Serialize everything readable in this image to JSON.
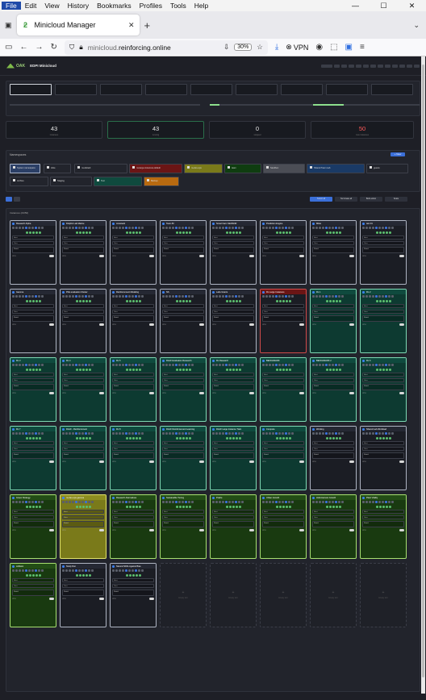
{
  "browser": {
    "menu": [
      "File",
      "Edit",
      "View",
      "History",
      "Bookmarks",
      "Profiles",
      "Tools",
      "Help"
    ],
    "tab_title": "Minicloud Manager",
    "url_host": "minicloud.",
    "url_domain": "reinforcing.online",
    "zoom": "30%",
    "vpn_label": "VPN"
  },
  "app": {
    "logo_text": "OAK",
    "title": "EDPI Minicloud",
    "stats": [
      {
        "value": "43",
        "label": "instances"
      },
      {
        "value": "43",
        "label": "running"
      },
      {
        "value": "0",
        "label": "stopped"
      },
      {
        "value": "50",
        "label": "max instances"
      }
    ],
    "namespaces_label": "Namespaces",
    "namespaces_btn": "+ New",
    "sessions_label": "Instances (43/50)",
    "toolbar_buttons": [
      "Select all",
      "Terminate all",
      "Bulk action",
      "Scale"
    ],
    "namespace_chips": [
      {
        "name": "System namespace",
        "color": "#2b3f66"
      },
      {
        "name": "Alice",
        "color": "#22242c"
      },
      {
        "name": "ns-default",
        "color": "#22242c"
      },
      {
        "name": "ns-large-instances-default",
        "color": "#6b1515"
      },
      {
        "name": "ns-dev-ops",
        "color": "#7a7a1a"
      },
      {
        "name": "team",
        "color": "#0f3d10"
      },
      {
        "name": "Sandbox",
        "color": "#4b4d55"
      },
      {
        "name": "Shared Team Lab",
        "color": "#1a3a66"
      },
      {
        "name": "guests",
        "color": "#22242c"
      },
      {
        "name": "Archive",
        "color": "#22242c"
      },
      {
        "name": "Staging",
        "color": "#22242c"
      },
      {
        "name": "Test",
        "color": "#0f4a3e"
      },
      {
        "name": "Backup",
        "color": "#b86a10"
      }
    ],
    "field_labels": {
      "host": "Host",
      "user": "User",
      "model": "Model",
      "cpu": "CPU"
    },
    "empty_label": "Empty slot",
    "cards": [
      {
        "name": "Research Alpha",
        "v": "dark"
      },
      {
        "name": "Dolphin Lab Marine",
        "v": "dark"
      },
      {
        "name": "corestack",
        "v": "dark"
      },
      {
        "name": "Team BI",
        "v": "dark"
      },
      {
        "name": "Smart Farm SENSOR",
        "v": "dark"
      },
      {
        "name": "Prediction Engine",
        "v": "dark"
      },
      {
        "name": "Miles",
        "v": "dark"
      },
      {
        "name": "test 01",
        "v": "dark"
      },
      {
        "name": "Gamma",
        "v": "dark"
      },
      {
        "name": "Pilot evaluation Cluster",
        "v": "dark"
      },
      {
        "name": "Reinforcement Modeling",
        "v": "dark"
      },
      {
        "name": "NS",
        "v": "dark"
      },
      {
        "name": "Labs Grants",
        "v": "dark"
      },
      {
        "name": "RL Large Instances",
        "v": "red"
      },
      {
        "name": "RL 1",
        "v": "green"
      },
      {
        "name": "RL 2",
        "v": "green"
      },
      {
        "name": "RL 3",
        "v": "green"
      },
      {
        "name": "RL 4",
        "v": "green"
      },
      {
        "name": "RL 5",
        "v": "green"
      },
      {
        "name": "RLHF Evaluation Research",
        "v": "green"
      },
      {
        "name": "RL Research",
        "v": "green"
      },
      {
        "name": "BENCHMARK",
        "v": "green"
      },
      {
        "name": "BENCHMARK 2",
        "v": "green"
      },
      {
        "name": "RL 6",
        "v": "green"
      },
      {
        "name": "RL 7",
        "v": "green"
      },
      {
        "name": "RLHF - Reinforcement",
        "v": "green"
      },
      {
        "name": "RL 8",
        "v": "green"
      },
      {
        "name": "RLHF Reinforcement Learning",
        "v": "green"
      },
      {
        "name": "RLHF Large Instance Train",
        "v": "green"
      },
      {
        "name": "Compute",
        "v": "green"
      },
      {
        "name": "Working",
        "v": "dark"
      },
      {
        "name": "Shared Lab Workload",
        "v": "dark"
      },
      {
        "name": "Green Strategy",
        "v": "lime"
      },
      {
        "name": "ns dev-ops gamma",
        "v": "olive"
      },
      {
        "name": "Research Alternatives",
        "v": "lime"
      },
      {
        "name": "Sustainable Tuning",
        "v": "lime"
      },
      {
        "name": "Prairie",
        "v": "lime"
      },
      {
        "name": "Urban Growth",
        "v": "lime"
      },
      {
        "name": "Hold-Harvest Growth",
        "v": "lime"
      },
      {
        "name": "Plant Vitality",
        "v": "lime"
      },
      {
        "name": "collision",
        "v": "lime"
      },
      {
        "name": "Study Run",
        "v": "dark"
      },
      {
        "name": "Natural Shifts Against Bias",
        "v": "dark"
      }
    ]
  }
}
